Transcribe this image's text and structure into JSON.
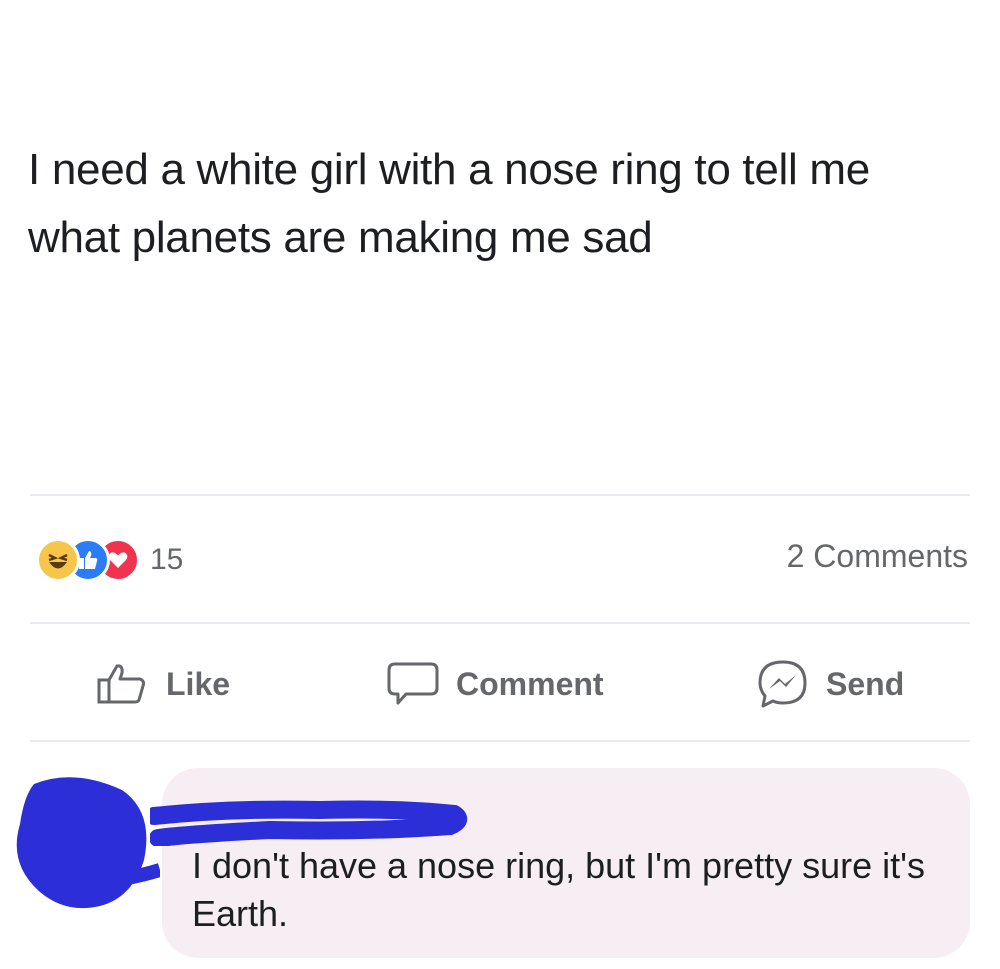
{
  "post": {
    "text": "I need a white girl with a nose ring to tell me what planets are making me sad"
  },
  "stats": {
    "reaction_count": "15",
    "comments_label": "2 Comments",
    "reactions": [
      "haha-icon",
      "like-icon",
      "love-icon"
    ]
  },
  "actions": {
    "like_label": "Like",
    "comment_label": "Comment",
    "send_label": "Send"
  },
  "comment": {
    "text": "I don't have a nose ring, but I'm pretty sure it's Earth."
  },
  "colors": {
    "scribble": "#2c2ed8",
    "bubble": "#f7eef3",
    "muted_text": "#65676b"
  }
}
